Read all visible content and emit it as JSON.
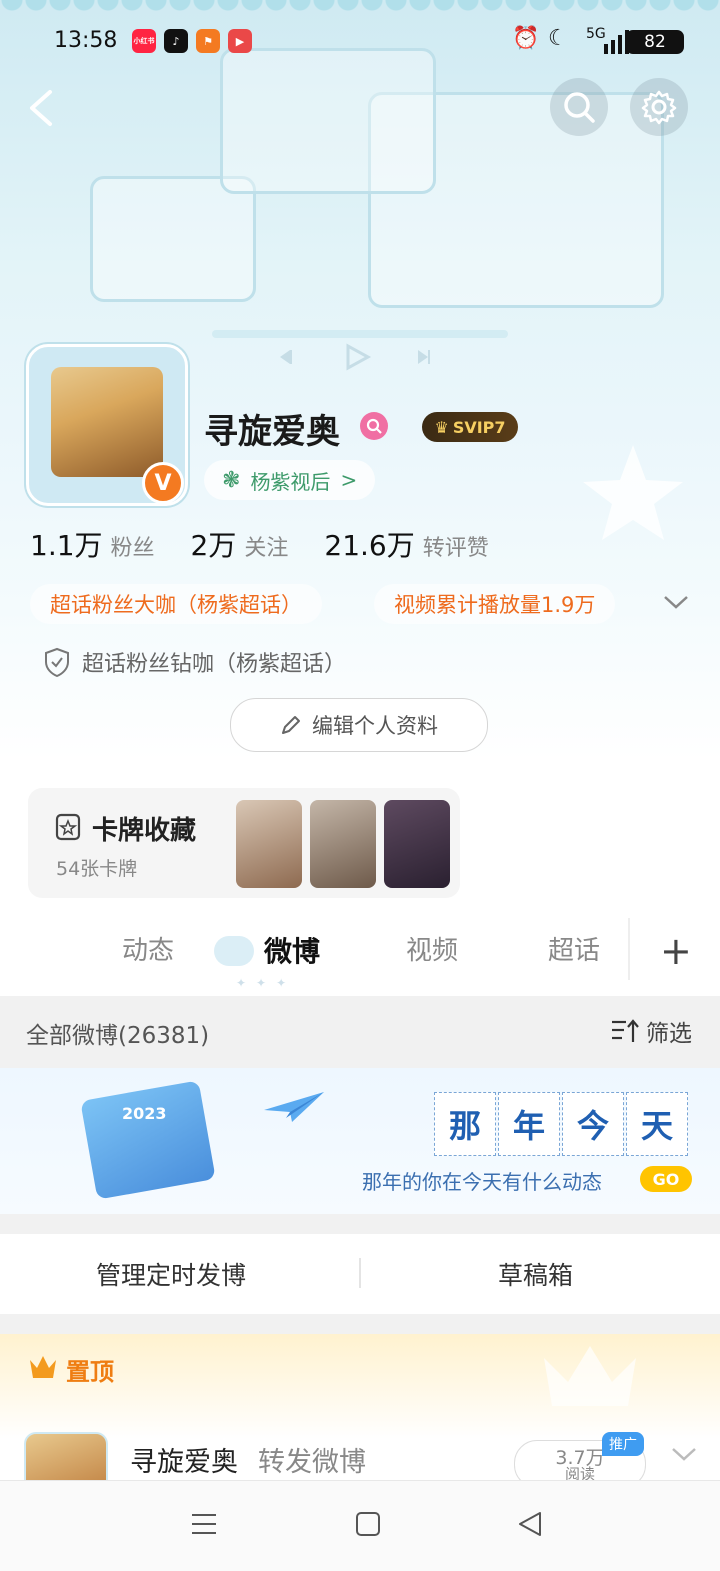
{
  "status_bar": {
    "time": "13:58",
    "apps": [
      "小红书",
      "抖音",
      "app3",
      "app4"
    ],
    "network": "5G",
    "battery": "82",
    "icons": [
      "alarm-icon",
      "moon-icon",
      "signal-icon"
    ]
  },
  "header": {
    "back_icon": "back-arrow-icon",
    "search_icon": "search-icon",
    "settings_icon": "gear-icon"
  },
  "profile": {
    "name": "寻旋爱奥",
    "vip": "SVIP7",
    "verified_badge": "V",
    "tag": "杨紫视后",
    "tag_arrow": ">",
    "followers_value": "1.1万",
    "followers_label": "粉丝",
    "following_value": "2万",
    "following_label": "关注",
    "likes_value": "21.6万",
    "likes_label": "转评赞",
    "badge1": "超话粉丝大咖（杨紫超话）",
    "badge2": "视频累计播放量1.9万",
    "fan_level": "超话粉丝钻咖（杨紫超话）",
    "edit_button": "编辑个人资料"
  },
  "card_collection": {
    "title": "卡牌收藏",
    "subtitle": "54张卡牌"
  },
  "tabs": {
    "items": [
      "动态",
      "微博",
      "视频",
      "超话"
    ],
    "active": "微博",
    "add": "+"
  },
  "feed": {
    "count_label": "全部微博(26381)",
    "filter_label": "筛选",
    "memory_chars": [
      "那",
      "年",
      "今",
      "天"
    ],
    "memory_calendar_year": "2023",
    "memory_subtitle": "那年的你在今天有什么动态",
    "memory_go": "GO",
    "manage_scheduled": "管理定时发博",
    "drafts": "草稿箱",
    "pinned_label": "置顶",
    "post_author": "寻旋爱奥",
    "post_action": "转发微博",
    "post_views": "3.7万",
    "post_views_label": "阅读",
    "promo_tag": "推广"
  },
  "colors": {
    "accent_orange": "#ee6b1e",
    "tag_green": "#3d9a6a",
    "vip_gold": "#f6cf62",
    "memory_blue": "#1f5fb2"
  }
}
